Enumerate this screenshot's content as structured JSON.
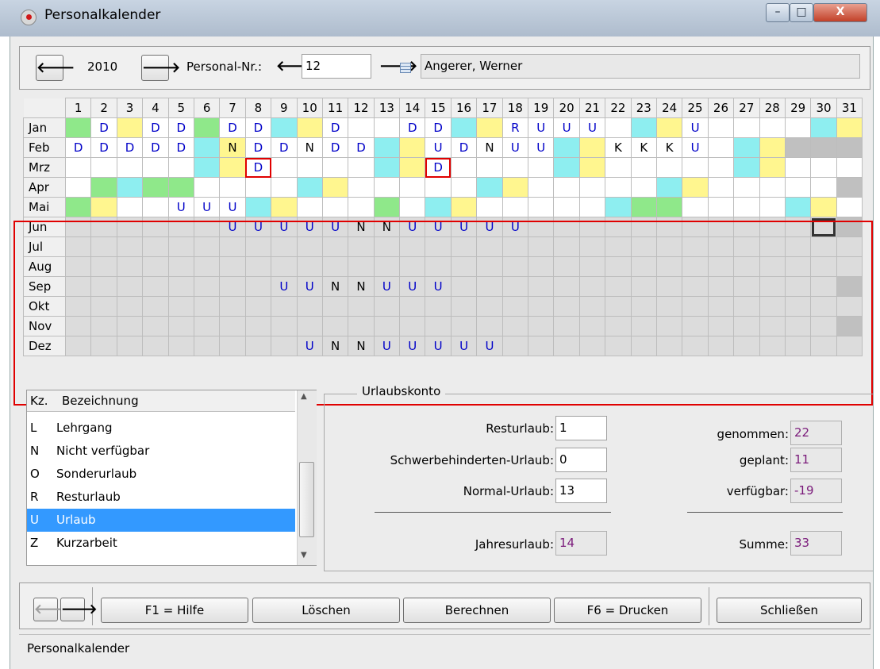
{
  "window": {
    "title": "Personalkalender",
    "min": "–",
    "max": "□",
    "close": "X"
  },
  "toolbar": {
    "year": "2010",
    "personal_label": "Personal-Nr.:",
    "personal_nr": "12",
    "name": "Angerer, Werner"
  },
  "calendar": {
    "days": [
      "1",
      "2",
      "3",
      "4",
      "5",
      "6",
      "7",
      "8",
      "9",
      "10",
      "11",
      "12",
      "13",
      "14",
      "15",
      "16",
      "17",
      "18",
      "19",
      "20",
      "21",
      "22",
      "23",
      "24",
      "25",
      "26",
      "27",
      "28",
      "29",
      "30",
      "31"
    ],
    "months": [
      "Jan",
      "Feb",
      "Mrz",
      "Apr",
      "Mai",
      "Jun",
      "Jul",
      "Aug",
      "Sep",
      "Okt",
      "Nov",
      "Dez"
    ],
    "rows": [
      {
        "month": "Jan",
        "codes": {
          "2": "D",
          "4": "D",
          "5": "D",
          "7": "D",
          "8": "D",
          "11": "D",
          "14": "D",
          "15": "D",
          "18": "R",
          "19": "U",
          "20": "U",
          "21": "U",
          "25": "U"
        },
        "colors": {
          "1": "#8fe88a",
          "3": "#fff68f",
          "6": "#8fe88a",
          "9": "#8eeef0",
          "10": "#fff68f",
          "16": "#8eeef0",
          "17": "#fff68f",
          "23": "#8eeef0",
          "24": "#fff68f",
          "30": "#8eeef0",
          "31": "#fff68f"
        }
      },
      {
        "month": "Feb",
        "codes": {
          "1": "D",
          "2": "D",
          "3": "D",
          "4": "D",
          "5": "D",
          "7": "N",
          "8": "D",
          "9": "D",
          "10": "N",
          "11": "D",
          "12": "D",
          "15": "U",
          "16": "D",
          "17": "N",
          "18": "U",
          "19": "U",
          "22": "K",
          "23": "K",
          "24": "K",
          "25": "U"
        },
        "colors": {
          "6": "#8eeef0",
          "7": "#fff68f",
          "13": "#8eeef0",
          "14": "#fff68f",
          "20": "#8eeef0",
          "21": "#fff68f",
          "27": "#8eeef0",
          "28": "#fff68f",
          "29": "#c0c0c0",
          "30": "#c0c0c0",
          "31": "#c0c0c0"
        }
      },
      {
        "month": "Mrz",
        "codes": {
          "8": "D",
          "15": "D"
        },
        "colors": {
          "6": "#8eeef0",
          "7": "#fff68f",
          "13": "#8eeef0",
          "14": "#fff68f",
          "20": "#8eeef0",
          "21": "#fff68f",
          "27": "#8eeef0",
          "28": "#fff68f"
        },
        "boxed": [
          "8",
          "15"
        ]
      },
      {
        "month": "Apr",
        "codes": {},
        "colors": {
          "2": "#8fe88a",
          "3": "#8eeef0",
          "4": "#8fe88a",
          "5": "#8fe88a",
          "10": "#8eeef0",
          "11": "#fff68f",
          "17": "#8eeef0",
          "18": "#fff68f",
          "24": "#8eeef0",
          "25": "#fff68f",
          "31": "#c0c0c0"
        }
      },
      {
        "month": "Mai",
        "codes": {
          "5": "U",
          "6": "U",
          "7": "U"
        },
        "colors": {
          "1": "#8fe88a",
          "2": "#fff68f",
          "8": "#8eeef0",
          "9": "#fff68f",
          "13": "#8fe88a",
          "15": "#8eeef0",
          "16": "#fff68f",
          "22": "#8eeef0",
          "23": "#8fe88a",
          "24": "#8fe88a",
          "29": "#8eeef0",
          "30": "#fff68f"
        }
      },
      {
        "month": "Jun",
        "codes": {
          "7": "U",
          "8": "U",
          "9": "U",
          "10": "U",
          "11": "U",
          "12": "N",
          "13": "N",
          "14": "U",
          "15": "U",
          "16": "U",
          "17": "U",
          "18": "U"
        },
        "colors": {}
      },
      {
        "month": "Jul",
        "codes": {},
        "colors": {}
      },
      {
        "month": "Aug",
        "codes": {},
        "colors": {}
      },
      {
        "month": "Sep",
        "codes": {
          "9": "U",
          "10": "U",
          "11": "N",
          "12": "N",
          "13": "U",
          "14": "U",
          "15": "U"
        },
        "colors": {}
      },
      {
        "month": "Okt",
        "codes": {},
        "colors": {}
      },
      {
        "month": "Nov",
        "codes": {},
        "colors": {}
      },
      {
        "month": "Dez",
        "codes": {
          "10": "U",
          "11": "N",
          "12": "N",
          "13": "U",
          "14": "U",
          "15": "U",
          "16": "U",
          "17": "U"
        },
        "colors": {}
      }
    ],
    "selected": {
      "month": "Jun",
      "day": "30"
    },
    "code_colors": {
      "D": "#0000c8",
      "U": "#0000c8",
      "R": "#0000c8",
      "N": "#000000",
      "K": "#000000"
    }
  },
  "legend": {
    "header": {
      "kz": "Kz.",
      "bezeichnung": "Bezeichnung"
    },
    "items": [
      {
        "kz": "L",
        "label": "Lehrgang"
      },
      {
        "kz": "N",
        "label": "Nicht verfügbar"
      },
      {
        "kz": "O",
        "label": "Sonderurlaub"
      },
      {
        "kz": "R",
        "label": "Resturlaub"
      },
      {
        "kz": "U",
        "label": "Urlaub",
        "selected": true
      },
      {
        "kz": "Z",
        "label": "Kurzarbeit"
      }
    ]
  },
  "urlaubskonto": {
    "title": "Urlaubskonto",
    "resturlaub_label": "Resturlaub:",
    "resturlaub": "1",
    "schwer_label": "Schwerbehinderten-Urlaub:",
    "schwer": "0",
    "normal_label": "Normal-Urlaub:",
    "normal": "13",
    "jahres_label": "Jahresurlaub:",
    "jahres": "14",
    "genommen_label": "genommen:",
    "genommen": "22",
    "geplant_label": "geplant:",
    "geplant": "11",
    "verfuegbar_label": "verfügbar:",
    "verfuegbar": "-19",
    "summe_label": "Summe:",
    "summe": "33"
  },
  "bottom": {
    "hilfe": "F1 = Hilfe",
    "loeschen": "Löschen",
    "berechnen": "Berechnen",
    "drucken": "F6 = Drucken",
    "schliessen": "Schließen"
  },
  "status": {
    "text": "Personalkalender"
  },
  "colors": {
    "selection_red": "#e00000",
    "list_selected": "#3399ff"
  }
}
